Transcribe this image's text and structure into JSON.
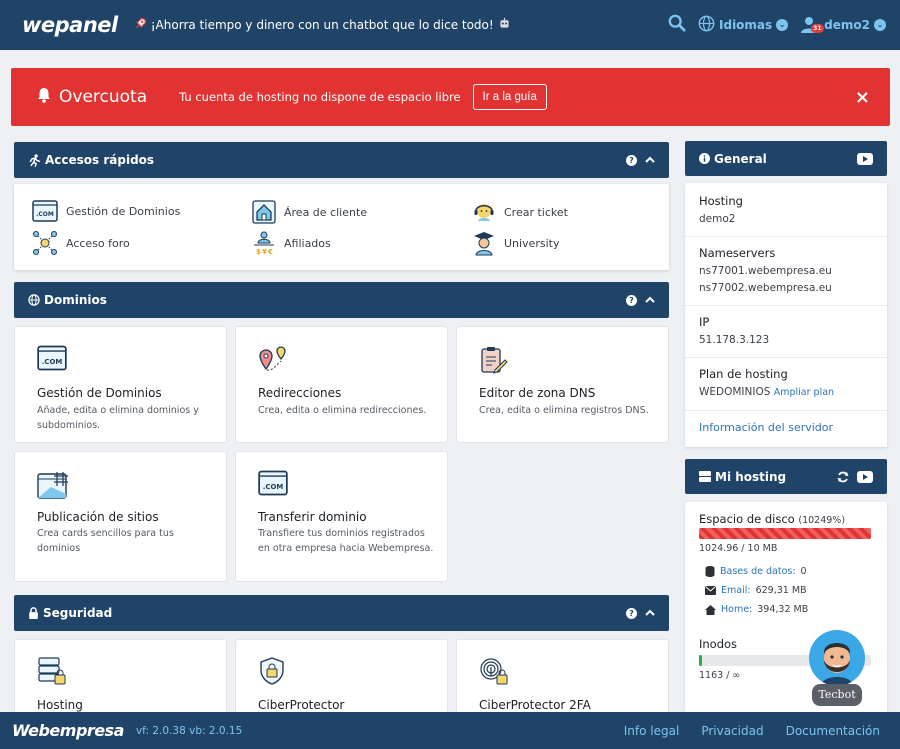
{
  "header": {
    "logo": "wepanel",
    "promo": "¡Ahorra tiempo y dinero con un chatbot que lo dice todo!",
    "languages_label": "Idiomas",
    "user_label": "demo2",
    "notification_count": "31"
  },
  "alert": {
    "title": "Overcuota",
    "message": "Tu cuenta de hosting no dispone de espacio libre",
    "button": "Ir a la guía",
    "close": "×"
  },
  "quick_access": {
    "title": "Accesos rápidos",
    "help": "?",
    "items": [
      {
        "label": "Gestión de Dominios",
        "icon": "dotcom-icon"
      },
      {
        "label": "Área de cliente",
        "icon": "house-icon"
      },
      {
        "label": "Crear ticket",
        "icon": "support-agent-icon"
      },
      {
        "label": "Acceso foro",
        "icon": "network-icon"
      },
      {
        "label": "Afiliados",
        "icon": "affiliate-icon"
      },
      {
        "label": "University",
        "icon": "graduate-icon"
      }
    ]
  },
  "domains": {
    "title": "Dominios",
    "help": "?",
    "cards": [
      {
        "title": "Gestión de Dominios",
        "desc": "Añade, edita o elimina dominios y subdominios."
      },
      {
        "title": "Redirecciones",
        "desc": "Crea, edita o elimina redirecciones."
      },
      {
        "title": "Editor de zona DNS",
        "desc": "Crea, edita o elimina registros DNS."
      },
      {
        "title": "Publicación de sitios",
        "desc": "Crea cards sencillos para tus dominios"
      },
      {
        "title": "Transferir dominio",
        "desc": "Transfiere tus dominios registrados en otra empresa hacia Webempresa."
      }
    ]
  },
  "security": {
    "title": "Seguridad",
    "help": "?",
    "cards": [
      {
        "title": "Hosting"
      },
      {
        "title": "CiberProtector"
      },
      {
        "title": "CiberProtector 2FA"
      }
    ]
  },
  "general": {
    "title": "General",
    "hosting_label": "Hosting",
    "hosting_value": "demo2",
    "ns_label": "Nameservers",
    "ns1": "ns77001.webempresa.eu",
    "ns2": "ns77002.webempresa.eu",
    "ip_label": "IP",
    "ip_value": "51.178.3.123",
    "plan_label": "Plan de hosting",
    "plan_value": "WEDOMINIOS",
    "plan_link": "Ampliar plan",
    "server_info": "Información del servidor"
  },
  "my_hosting": {
    "title": "Mi hosting",
    "disk_label": "Espacio de disco",
    "disk_percent": "(10249%)",
    "disk_usage": "1024.96 / 10 MB",
    "databases_label": "Bases de datos:",
    "databases_value": "0",
    "email_label": "Email:",
    "email_value": "629,31 MB",
    "home_label": "Home:",
    "home_value": "394,32 MB",
    "inodes_label": "Inodos",
    "inodes_usage": "1163 / ∞",
    "inodes_fill_percent": 2
  },
  "footer": {
    "logo": "Webempresa",
    "version": "vf: 2.0.38 vb: 2.0.15",
    "links": [
      "Info legal",
      "Privacidad",
      "Documentación"
    ]
  },
  "tecbot": {
    "label": "Tecbot"
  },
  "colors": {
    "primary": "#1f4467",
    "alert": "#e23333",
    "link": "#2c73b8",
    "accent": "#7ec3f0"
  }
}
